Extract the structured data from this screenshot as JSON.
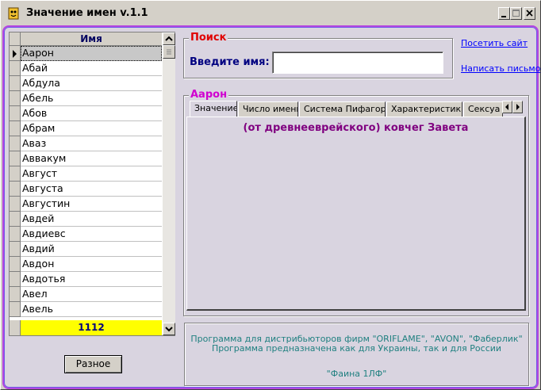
{
  "window": {
    "title": "Значение имен v.1.1"
  },
  "names_grid": {
    "header": "Имя",
    "rows": [
      "Аарон",
      "Абай",
      "Абдула",
      "Абель",
      "Абов",
      "Абрам",
      "Аваз",
      "Аввакум",
      "Август",
      "Августа",
      "Августин",
      "Авдей",
      "Авдиевс",
      "Авдий",
      "Авдон",
      "Авдотья",
      "Авел",
      "Авель"
    ],
    "selected_index": 0,
    "count": "1112"
  },
  "buttons": {
    "misc": "Разное"
  },
  "search": {
    "group_title": "Поиск",
    "label": "Введите имя:",
    "value": "",
    "placeholder": ""
  },
  "links": {
    "visit_site": "Посетить сайт",
    "write_letter": "Написать письмо"
  },
  "result": {
    "group_title": "Аарон",
    "tabs": [
      "Значение",
      "Число имени",
      "Система Пифагора",
      "Характеристика",
      "Сексуа"
    ],
    "active_tab": 0,
    "meaning": "(от древнееврейского) ковчег Завета"
  },
  "info": {
    "line1": "Программа для дистрибьюторов фирм \"ORIFLAME\", \"AVON\", \"Фаберлик\"",
    "line2": "Программа предназначена как для Украины, так и для России",
    "line3": "\"Фаина 1ЛФ\""
  },
  "colors": {
    "search_title": "#e00000",
    "result_title": "#d000d0",
    "meaning": "#800080",
    "footer_bg": "#ffff00",
    "link": "#0000ff",
    "border_glow": "#b446e0"
  }
}
